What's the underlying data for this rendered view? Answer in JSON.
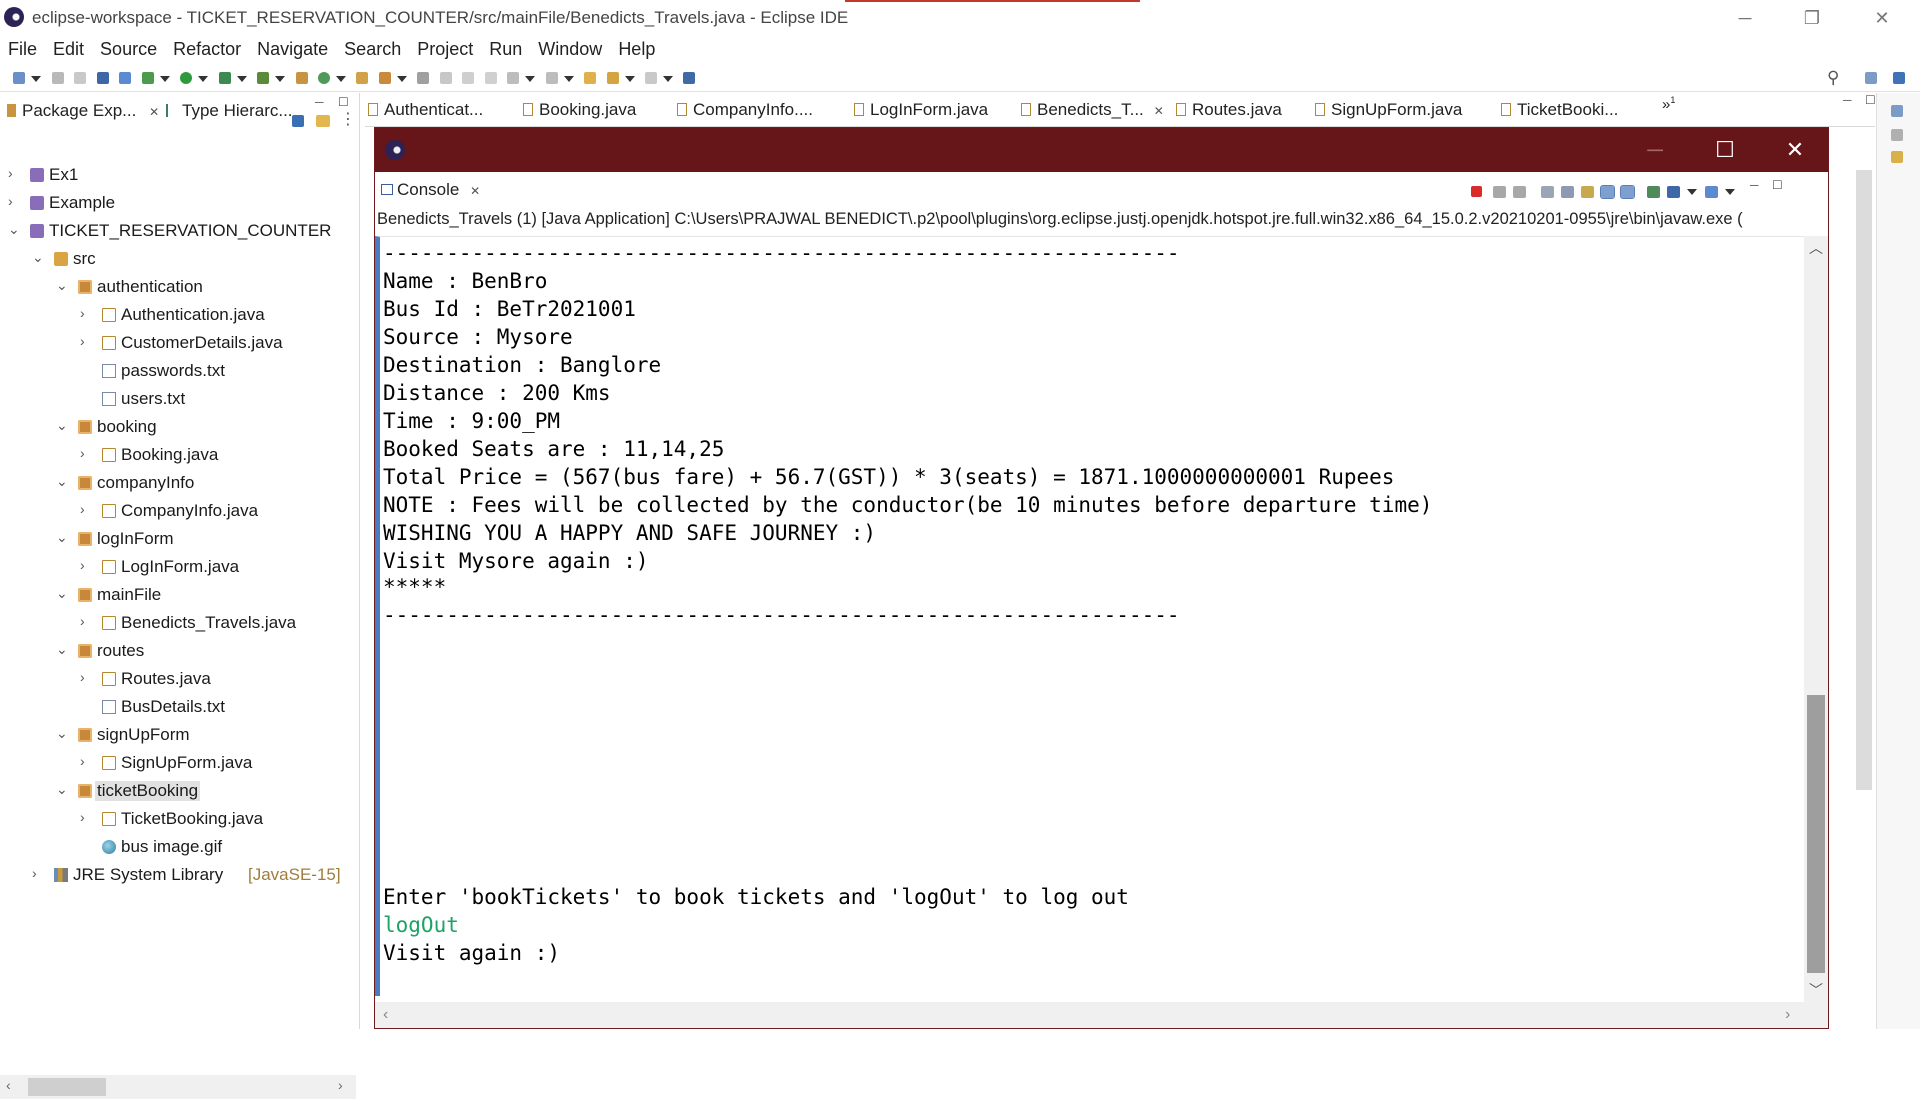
{
  "window": {
    "title": "eclipse-workspace - TICKET_RESERVATION_COUNTER/src/mainFile/Benedicts_Travels.java - Eclipse IDE",
    "controls": {
      "minimize": "─",
      "restore": "❐",
      "close": "✕"
    }
  },
  "menu": [
    "File",
    "Edit",
    "Source",
    "Refactor",
    "Navigate",
    "Search",
    "Project",
    "Run",
    "Window",
    "Help"
  ],
  "left_panel": {
    "tabs": [
      {
        "label": "Package Exp...",
        "close": "✕"
      },
      {
        "label": "Type Hierarc..."
      }
    ],
    "tree": [
      {
        "label": "Ex1",
        "chev": "›",
        "icon": "project-icon"
      },
      {
        "label": "Example",
        "chev": "›",
        "icon": "project-icon"
      },
      {
        "label": "TICKET_RESERVATION_COUNTER",
        "chev": "⌄",
        "icon": "project-icon"
      },
      {
        "label": "src",
        "chev": "⌄",
        "icon": "source-folder-icon"
      },
      {
        "label": "authentication",
        "chev": "⌄",
        "icon": "package-icon"
      },
      {
        "label": "Authentication.java",
        "chev": "›",
        "icon": "java-file-icon"
      },
      {
        "label": "CustomerDetails.java",
        "chev": "›",
        "icon": "java-file-icon"
      },
      {
        "label": "passwords.txt",
        "chev": "",
        "icon": "text-file-icon"
      },
      {
        "label": "users.txt",
        "chev": "",
        "icon": "text-file-icon"
      },
      {
        "label": "booking",
        "chev": "⌄",
        "icon": "package-icon"
      },
      {
        "label": "Booking.java",
        "chev": "›",
        "icon": "java-file-icon"
      },
      {
        "label": "companyInfo",
        "chev": "⌄",
        "icon": "package-icon"
      },
      {
        "label": "CompanyInfo.java",
        "chev": "›",
        "icon": "java-file-icon"
      },
      {
        "label": "logInForm",
        "chev": "⌄",
        "icon": "package-icon"
      },
      {
        "label": "LogInForm.java",
        "chev": "›",
        "icon": "java-file-icon"
      },
      {
        "label": "mainFile",
        "chev": "⌄",
        "icon": "package-icon"
      },
      {
        "label": "Benedicts_Travels.java",
        "chev": "›",
        "icon": "java-file-icon"
      },
      {
        "label": "routes",
        "chev": "⌄",
        "icon": "package-icon"
      },
      {
        "label": "Routes.java",
        "chev": "›",
        "icon": "java-file-icon"
      },
      {
        "label": "BusDetails.txt",
        "chev": "",
        "icon": "text-file-icon"
      },
      {
        "label": "signUpForm",
        "chev": "⌄",
        "icon": "package-icon"
      },
      {
        "label": "SignUpForm.java",
        "chev": "›",
        "icon": "java-file-icon"
      },
      {
        "label": "ticketBooking",
        "chev": "⌄",
        "icon": "package-icon"
      },
      {
        "label": "TicketBooking.java",
        "chev": "›",
        "icon": "java-file-icon"
      },
      {
        "label": "bus image.gif",
        "chev": "",
        "icon": "gif-file-icon"
      },
      {
        "label": "JRE System Library",
        "suffix": "[JavaSE-15]",
        "chev": "›",
        "icon": "library-icon"
      }
    ]
  },
  "editor_tabs": [
    {
      "label": "Authenticat..."
    },
    {
      "label": "Booking.java"
    },
    {
      "label": "CompanyInfo...."
    },
    {
      "label": "LogInForm.java"
    },
    {
      "label": "Benedicts_T...",
      "close": "✕"
    },
    {
      "label": "Routes.java"
    },
    {
      "label": "SignUpForm.java"
    },
    {
      "label": "TicketBooki..."
    }
  ],
  "overflow_label": "»",
  "overflow_count": "1",
  "console": {
    "tab_label": "Console",
    "tab_close": "✕",
    "description": "Benedicts_Travels (1) [Java Application] C:\\Users\\PRAJWAL BENEDICT\\.p2\\pool\\plugins\\org.eclipse.justj.openjdk.hotspot.jre.full.win32.x86_64_15.0.2.v20210201-0955\\jre\\bin\\javaw.exe  (",
    "lines": [
      {
        "text": "---------------------------------------------------------------",
        "type": "output"
      },
      {
        "text": "Name : BenBro",
        "type": "output"
      },
      {
        "text": "Bus Id : BeTr2021001",
        "type": "output"
      },
      {
        "text": "Source : Mysore",
        "type": "output"
      },
      {
        "text": "Destination : Banglore",
        "type": "output"
      },
      {
        "text": "Distance : 200 Kms",
        "type": "output"
      },
      {
        "text": "Time : 9:00_PM",
        "type": "output"
      },
      {
        "text": "Booked Seats are : 11,14,25",
        "type": "output"
      },
      {
        "text": "Total Price = (567(bus fare) + 56.7(GST)) * 3(seats) = 1871.1000000000001 Rupees",
        "type": "output"
      },
      {
        "text": "NOTE : Fees will be collected by the conductor(be 10 minutes before departure time)",
        "type": "output"
      },
      {
        "text": "WISHING YOU A HAPPY AND SAFE JOURNEY :)",
        "type": "output"
      },
      {
        "text": "Visit Mysore again :)",
        "type": "output"
      },
      {
        "text": "*****",
        "type": "output"
      },
      {
        "text": "---------------------------------------------------------------",
        "type": "output"
      },
      {
        "text": "Enter 'bookTickets' to book tickets and 'logOut' to log out",
        "type": "output"
      },
      {
        "text": "logOut",
        "type": "input"
      },
      {
        "text": "Visit again :)",
        "type": "output"
      }
    ]
  },
  "colors": {
    "console_titlebar": "#661518",
    "console_input_text": "#1fa266",
    "console_stream_bar": "#4a7cc0",
    "library_suffix": "#a07d3c"
  }
}
